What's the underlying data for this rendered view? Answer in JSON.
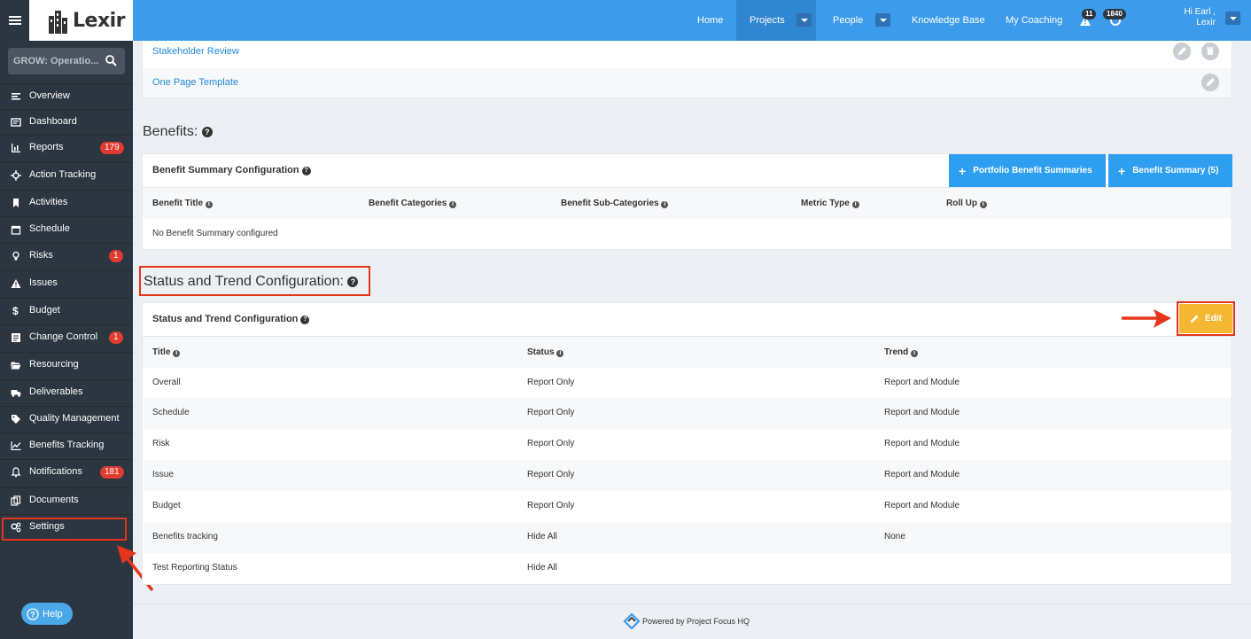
{
  "app": {
    "brand": "Lexir"
  },
  "topnav": {
    "items": [
      {
        "label": "Home"
      },
      {
        "label": "Projects"
      },
      {
        "label": "People"
      },
      {
        "label": "Knowledge Base"
      },
      {
        "label": "My Coaching"
      }
    ],
    "alerts_count": "11",
    "help_count": "1840",
    "user_greeting": "Hi Earl ,",
    "user_org": "Lexir"
  },
  "sidebar": {
    "search_value": "GROW: Operatio...",
    "items": [
      {
        "label": "Overview",
        "icon": "overview-icon"
      },
      {
        "label": "Dashboard",
        "icon": "dashboard-icon"
      },
      {
        "label": "Reports",
        "icon": "reports-icon",
        "badge": "179"
      },
      {
        "label": "Action Tracking",
        "icon": "action-tracking-icon"
      },
      {
        "label": "Activities",
        "icon": "activities-icon"
      },
      {
        "label": "Schedule",
        "icon": "schedule-icon"
      },
      {
        "label": "Risks",
        "icon": "risks-icon",
        "badge": "1"
      },
      {
        "label": "Issues",
        "icon": "issues-icon"
      },
      {
        "label": "Budget",
        "icon": "budget-icon"
      },
      {
        "label": "Change Control",
        "icon": "change-control-icon",
        "badge": "1"
      },
      {
        "label": "Resourcing",
        "icon": "resourcing-icon"
      },
      {
        "label": "Deliverables",
        "icon": "deliverables-icon"
      },
      {
        "label": "Quality Management",
        "icon": "quality-icon"
      },
      {
        "label": "Benefits Tracking",
        "icon": "benefits-icon"
      },
      {
        "label": "Notifications",
        "icon": "notifications-icon",
        "badge": "181"
      },
      {
        "label": "Documents",
        "icon": "documents-icon"
      },
      {
        "label": "Settings",
        "icon": "settings-icon"
      }
    ],
    "help_label": "Help"
  },
  "templates": {
    "items": [
      {
        "label": "Stakeholder Review"
      },
      {
        "label": "One Page Template"
      }
    ]
  },
  "benefits": {
    "section_title": "Benefits:",
    "panel_title": "Benefit Summary Configuration",
    "portfolio_button": "Portfolio Benefit Summaries",
    "summary_button": "Benefit Summary (5)",
    "columns": [
      "Benefit Title",
      "Benefit Categories",
      "Benefit Sub-Categories",
      "Metric Type",
      "Roll Up"
    ],
    "empty_text": "No Benefit Summary configured"
  },
  "status_trend": {
    "section_title": "Status and Trend Configuration:",
    "panel_title": "Status and Trend Configuration",
    "edit_button": "Edit",
    "columns": [
      "Title",
      "Status",
      "Trend"
    ],
    "rows": [
      {
        "title": "Overall",
        "status": "Report Only",
        "trend": "Report and Module"
      },
      {
        "title": "Schedule",
        "status": "Report Only",
        "trend": "Report and Module"
      },
      {
        "title": "Risk",
        "status": "Report Only",
        "trend": "Report and Module"
      },
      {
        "title": "Issue",
        "status": "Report Only",
        "trend": "Report and Module"
      },
      {
        "title": "Budget",
        "status": "Report Only",
        "trend": "Report and Module"
      },
      {
        "title": "Benefits tracking",
        "status": "Hide All",
        "trend": "None"
      },
      {
        "title": "Test Reporting Status",
        "status": "Hide All",
        "trend": ""
      }
    ]
  },
  "footer": {
    "text": "Powered by Project Focus HQ"
  },
  "colors": {
    "topbar": "#3c9bea",
    "sidebar": "#2b3640",
    "accent_blue": "#2d9ef0",
    "edit_orange": "#f5b731",
    "highlight_red": "#e5361c",
    "badge_red": "#e03b2e"
  }
}
